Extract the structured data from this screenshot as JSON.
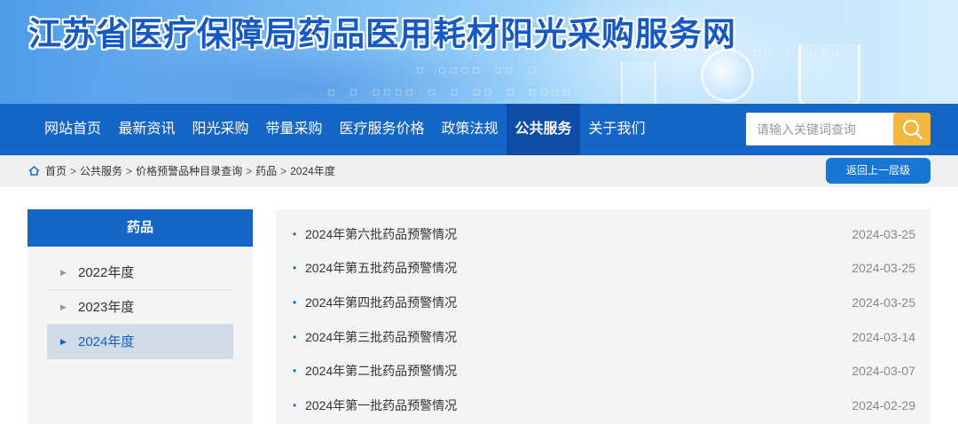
{
  "header": {
    "site_title": "江苏省医疗保障局药品医用耗材阳光采购服务网"
  },
  "nav": {
    "items": [
      {
        "label": "网站首页"
      },
      {
        "label": "最新资讯"
      },
      {
        "label": "阳光采购"
      },
      {
        "label": "带量采购"
      },
      {
        "label": "医疗服务价格"
      },
      {
        "label": "政策法规"
      },
      {
        "label": "公共服务",
        "active": true
      },
      {
        "label": "关于我们"
      }
    ],
    "search_placeholder": "请输入关键词查询",
    "search_icon": "search-icon"
  },
  "breadcrumb": {
    "icon": "home-icon",
    "items": [
      "首页",
      "公共服务",
      "价格预警品种目录查询",
      "药品",
      "2024年度"
    ],
    "separator": ">",
    "back_label": "返回上一层级"
  },
  "sidebar": {
    "title": "药品",
    "items": [
      {
        "label": "2022年度"
      },
      {
        "label": "2023年度"
      },
      {
        "label": "2024年度",
        "active": true
      }
    ]
  },
  "articles": [
    {
      "title": "2024年第六批药品预警情况",
      "date": "2024-03-25"
    },
    {
      "title": "2024年第五批药品预警情况",
      "date": "2024-03-25"
    },
    {
      "title": "2024年第四批药品预警情况",
      "date": "2024-03-25"
    },
    {
      "title": "2024年第三批药品预警情况",
      "date": "2024-03-14"
    },
    {
      "title": "2024年第二批药品预警情况",
      "date": "2024-03-07"
    },
    {
      "title": "2024年第一批药品预警情况",
      "date": "2024-02-29"
    }
  ],
  "colors": {
    "primary": "#1566c6",
    "nav_active": "#0e4ea8",
    "search_button": "#f5b63c",
    "back_button": "#1877d4",
    "sidebar_active_bg": "#cfdbe6"
  }
}
